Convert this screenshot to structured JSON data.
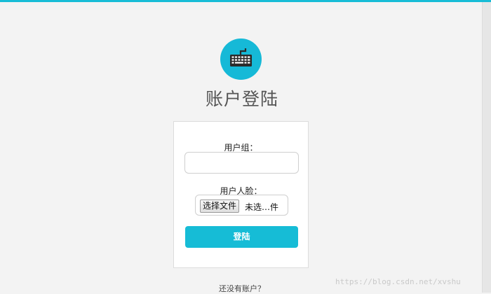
{
  "page": {
    "title": "账户登陆"
  },
  "logo": {
    "icon": "keyboard-icon",
    "color": "#16b9d7"
  },
  "form": {
    "group_label": "用户组：",
    "group_value": "",
    "face_label": "用户人脸：",
    "file_button_label": "选择文件",
    "file_status": "未选…件",
    "submit_label": "登陆"
  },
  "footer": {
    "register_link": "还没有账户？"
  },
  "watermark": {
    "text": "https://blog.csdn.net/xvshu"
  },
  "colors": {
    "accent": "#16bcd6",
    "background": "#f3f3f3"
  }
}
